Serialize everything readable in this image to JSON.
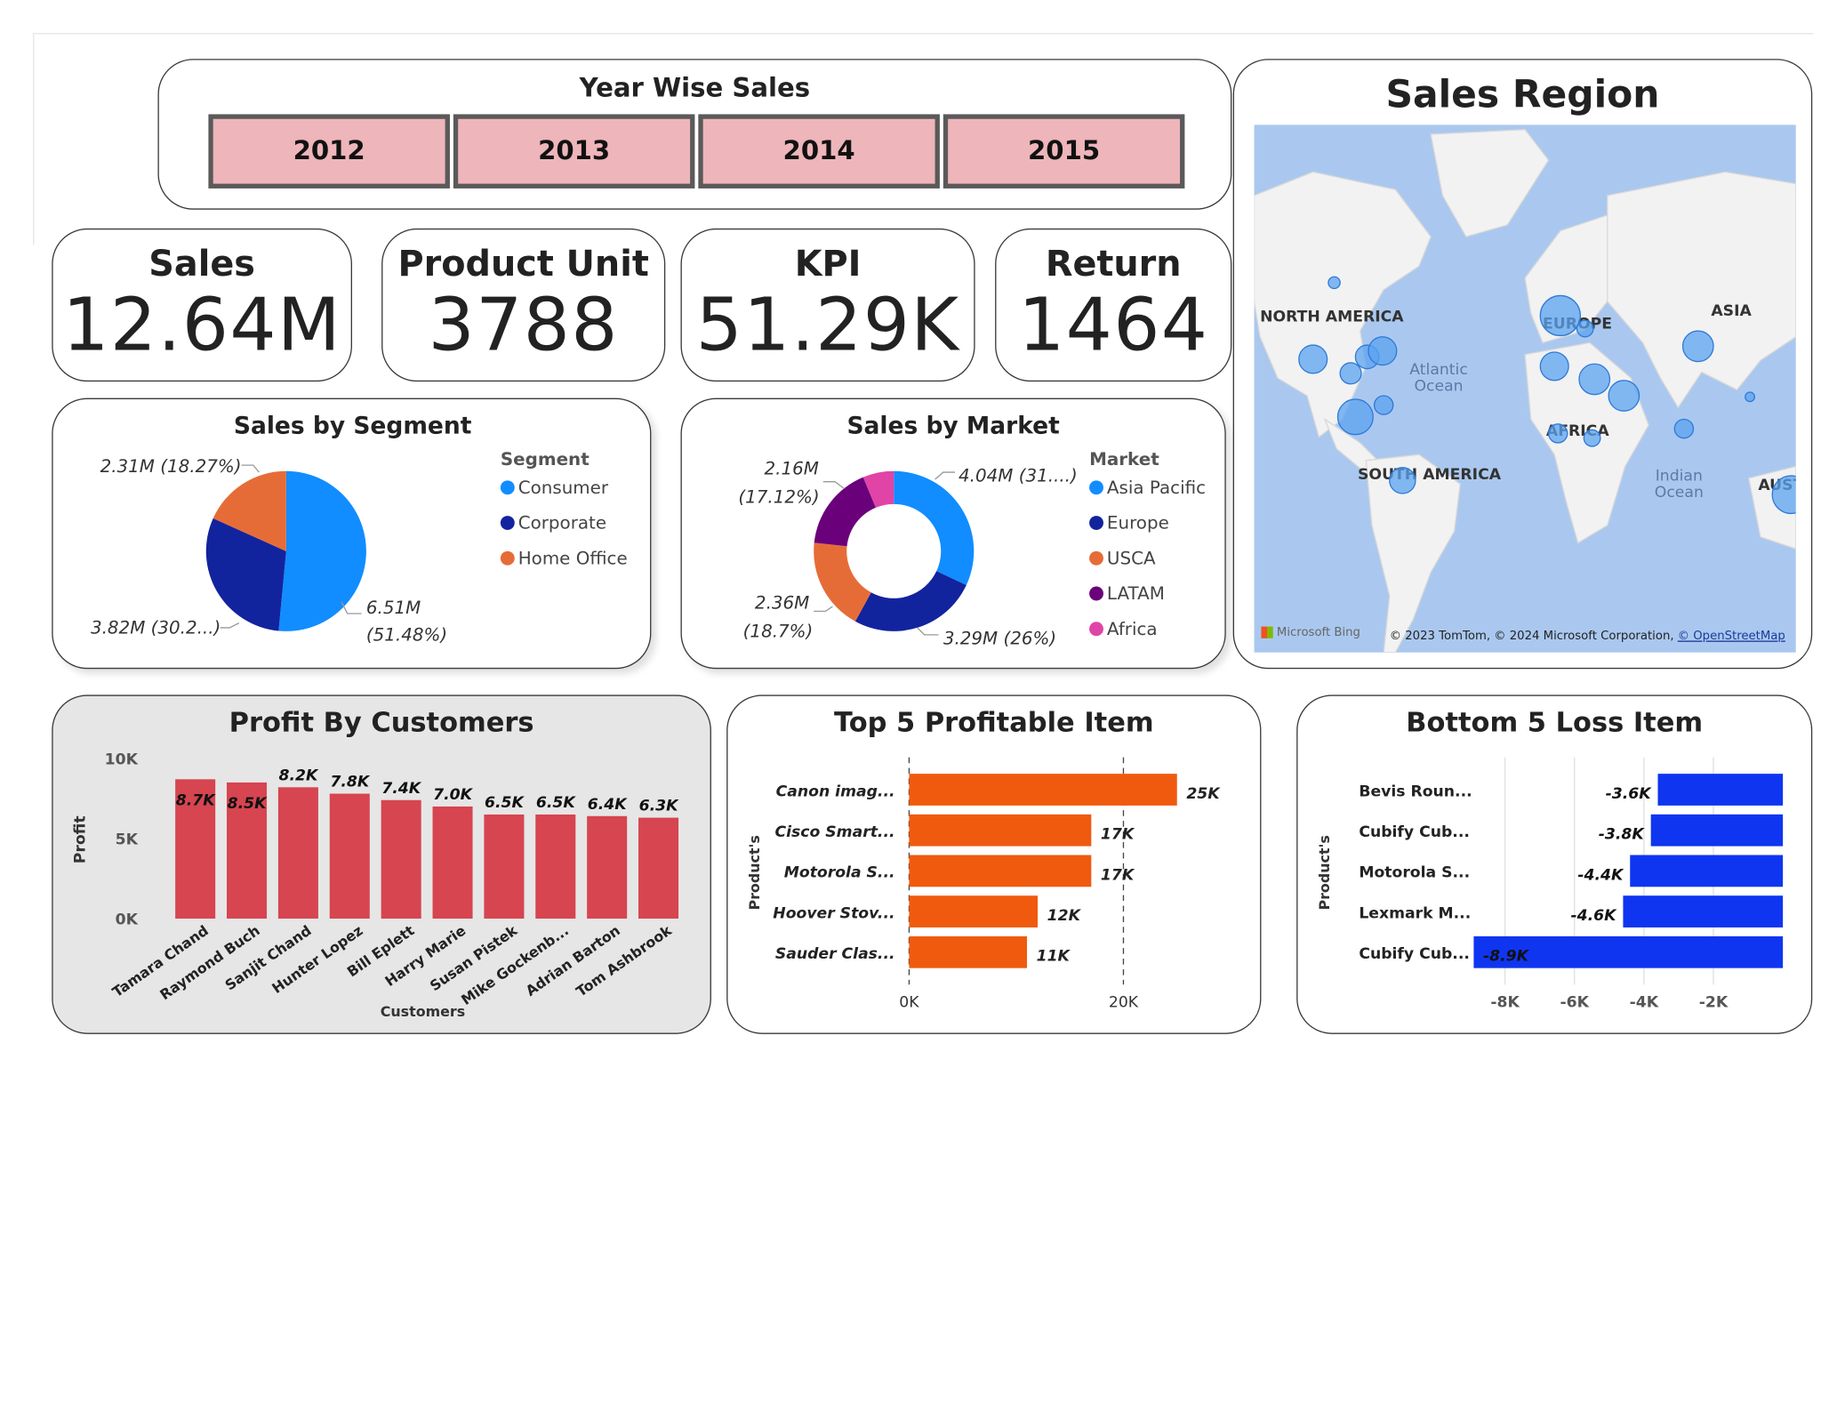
{
  "year_slicer": {
    "title": "Year Wise Sales",
    "years": [
      "2012",
      "2013",
      "2014",
      "2015"
    ]
  },
  "kpis": [
    {
      "label": "Sales",
      "value": "12.64M"
    },
    {
      "label": "Product Unit",
      "value": "3788"
    },
    {
      "label": "KPI",
      "value": "51.29K"
    },
    {
      "label": "Return",
      "value": "1464"
    }
  ],
  "map": {
    "title": "Sales Region",
    "regions": [
      "NORTH AMERICA",
      "EUROPE",
      "ASIA",
      "AFRICA",
      "SOUTH AMERICA",
      "AUST"
    ],
    "oceans": [
      "Atlantic\nOcean",
      "Indian\nOcean"
    ],
    "bing_logo": "Microsoft Bing",
    "copyright": "© 2023 TomTom, © 2024 Microsoft Corporation,",
    "osm_link": "© OpenStreetMap",
    "bubble_color": "#5ba3ef"
  },
  "chart_data": [
    {
      "type": "pie",
      "title": "Sales by Segment",
      "legend_title": "Segment",
      "categories": [
        "Consumer",
        "Corporate",
        "Home Office"
      ],
      "values": [
        6.51,
        3.82,
        2.31
      ],
      "percentages": [
        51.48,
        30.2,
        18.27
      ],
      "data_labels": [
        "6.51M (51.48%)",
        "3.82M (30.2...)",
        "2.31M (18.27%)"
      ],
      "colors": [
        "#118dff",
        "#12239e",
        "#e66c37"
      ]
    },
    {
      "type": "pie",
      "title": "Sales by Market",
      "legend_title": "Market",
      "categories": [
        "Asia Pacific",
        "Europe",
        "USCA",
        "LATAM",
        "Africa"
      ],
      "values": [
        4.04,
        3.29,
        2.36,
        2.16,
        0.79
      ],
      "percentages": [
        31.96,
        26,
        18.7,
        17.12,
        6.22
      ],
      "data_labels": [
        "4.04M (31....)",
        "3.29M (26%)",
        "2.36M (18.7%)",
        "2.16M (17.12%)",
        ""
      ],
      "colors": [
        "#118dff",
        "#12239e",
        "#e66c37",
        "#6b007b",
        "#e044a7"
      ]
    },
    {
      "type": "bar",
      "title": "Profit By Customers",
      "xlabel": "Customers",
      "ylabel": "Profit",
      "categories": [
        "Tamara Chand",
        "Raymond Buch",
        "Sanjit Chand",
        "Hunter Lopez",
        "Bill Eplett",
        "Harry Marie",
        "Susan Pistek",
        "Mike Gockenb...",
        "Adrian Barton",
        "Tom Ashbrook"
      ],
      "values": [
        8700,
        8500,
        8200,
        7800,
        7400,
        7000,
        6500,
        6500,
        6400,
        6300
      ],
      "data_labels": [
        "8.7K",
        "8.5K",
        "8.2K",
        "7.8K",
        "7.4K",
        "7.0K",
        "6.5K",
        "6.5K",
        "6.4K",
        "6.3K"
      ],
      "yticks": [
        "0K",
        "5K",
        "10K"
      ],
      "ylim": [
        0,
        10000
      ],
      "color": "#d64550"
    },
    {
      "type": "bar",
      "orientation": "horizontal",
      "title": "Top 5 Profitable Item",
      "ylabel": "Product's",
      "categories": [
        "Canon imag...",
        "Cisco Smart...",
        "Motorola S...",
        "Hoover Stov...",
        "Sauder Clas..."
      ],
      "values": [
        25000,
        17000,
        17000,
        12000,
        11000
      ],
      "data_labels": [
        "25K",
        "17K",
        "17K",
        "12K",
        "11K"
      ],
      "xticks": [
        "0K",
        "20K"
      ],
      "color": "#f05a0e"
    },
    {
      "type": "bar",
      "orientation": "horizontal",
      "title": "Bottom 5 Loss Item",
      "ylabel": "Product's",
      "categories": [
        "Bevis Roun...",
        "Cubify Cub...",
        "Motorola S...",
        "Lexmark M...",
        "Cubify Cub..."
      ],
      "values": [
        -3600,
        -3800,
        -4400,
        -4600,
        -8900
      ],
      "data_labels": [
        "-3.6K",
        "-3.8K",
        "-4.4K",
        "-4.6K",
        "-8.9K"
      ],
      "xticks": [
        "-8K",
        "-6K",
        "-4K",
        "-2K"
      ],
      "color": "#0f35f0"
    }
  ]
}
